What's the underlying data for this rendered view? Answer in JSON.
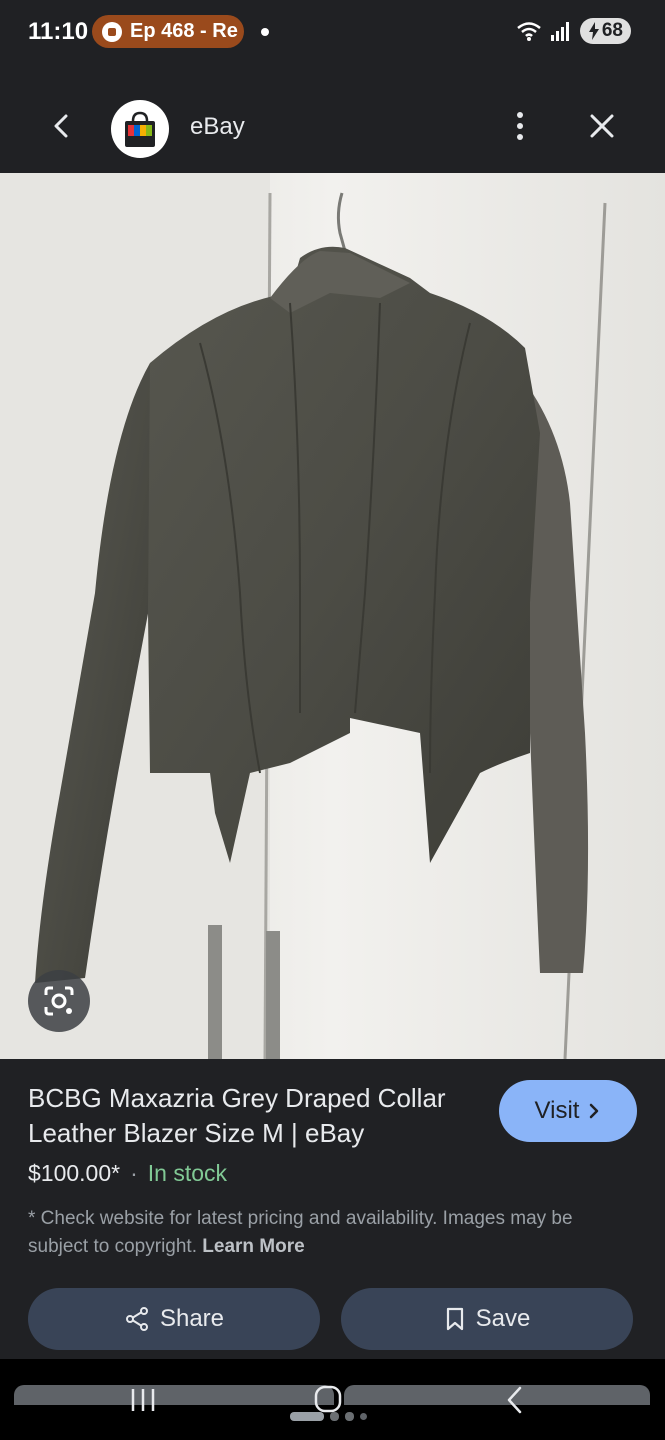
{
  "status_bar": {
    "time": "11:10",
    "notification_pill": "Ep 468 - Re",
    "battery": "68",
    "icons": [
      "podcast-icon",
      "wifi-icon",
      "signal-icon",
      "battery-charging-icon"
    ]
  },
  "header": {
    "title": "eBay",
    "back_icon": "chevron-left-icon",
    "menu_icon": "more-vert-icon",
    "close_icon": "close-icon"
  },
  "image": {
    "lens_icon": "google-lens-icon"
  },
  "product": {
    "title": "BCBG Maxazria Grey Draped Collar Leather Blazer Size M | eBay",
    "visit_label": "Visit",
    "price": "$100.00*",
    "separator": "·",
    "stock": "In stock",
    "disclaimer": "* Check website for latest pricing and availability. Images may be subject to copyright.",
    "learn_more": "Learn More",
    "share_label": "Share",
    "save_label": "Save"
  },
  "colors": {
    "background": "#202124",
    "accent": "#8ab4f8",
    "stock": "#81c995",
    "button": "#394457",
    "pill": "#9a4a1c"
  },
  "nav": {
    "icons": [
      "recents-icon",
      "home-icon",
      "back-icon"
    ]
  }
}
